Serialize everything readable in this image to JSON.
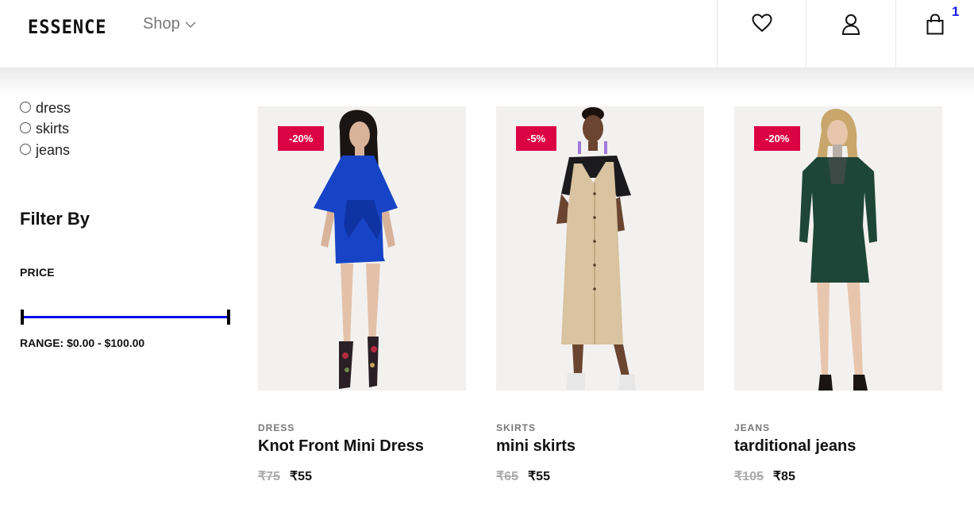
{
  "header": {
    "logo": "ESSENCE",
    "shop_label": "Shop",
    "cart_count": "1"
  },
  "sidebar": {
    "categories": [
      {
        "label": "dress"
      },
      {
        "label": "skirts"
      },
      {
        "label": "jeans"
      }
    ],
    "filter_title": "Filter By",
    "price_label": "PRICE",
    "range_label": "RANGE: $0.00 - $100.00"
  },
  "products": [
    {
      "badge": "-20%",
      "category": "DRESS",
      "title": "Knot Front Mini Dress",
      "old_price": "₹75",
      "new_price": "₹55",
      "garment_color": "#1744c6"
    },
    {
      "badge": "-5%",
      "category": "SKIRTS",
      "title": "mini skirts",
      "old_price": "₹65",
      "new_price": "₹55",
      "garment_color": "#d9c3a0"
    },
    {
      "badge": "-20%",
      "category": "JEANS",
      "title": "tarditional jeans",
      "old_price": "₹105",
      "new_price": "₹85",
      "garment_color": "#1e4638"
    }
  ],
  "colors": {
    "badge": "#dc0345",
    "slider_track": "#0a0aef",
    "cart_count": "#1a1aee"
  }
}
